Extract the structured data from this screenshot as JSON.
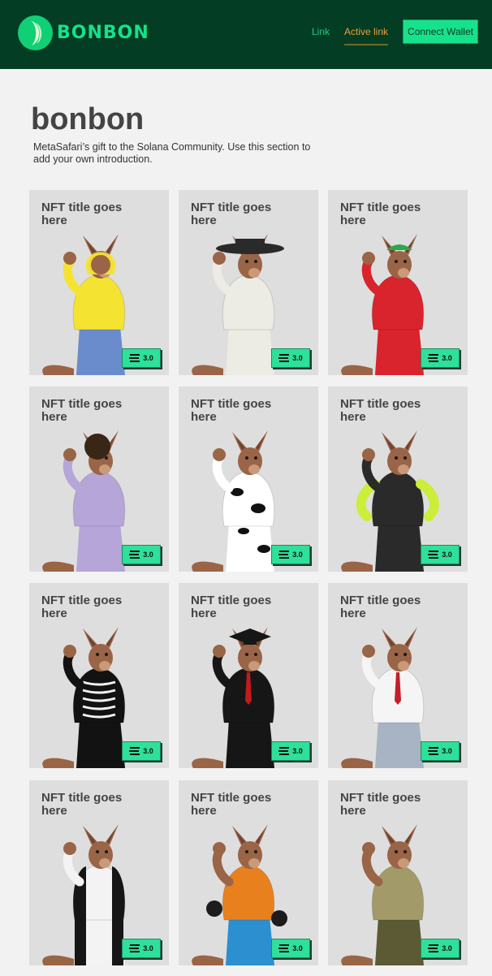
{
  "brand": {
    "name": "BONBON"
  },
  "nav": {
    "link": "Link",
    "active_link": "Active link",
    "wallet_button": "Connect Wallet"
  },
  "hero": {
    "title": "bonbon",
    "intro": "MetaSafari’s gift to the Solana Community. Use this section to add your own introduction."
  },
  "cards": [
    {
      "title": "NFT title goes here",
      "price": "3.0",
      "outfit": "yellow-raincoat",
      "colors": {
        "main": "#f4e431",
        "accent": "#6a8ccc"
      }
    },
    {
      "title": "NFT title goes here",
      "price": "3.0",
      "outfit": "black-hat-white-dress",
      "colors": {
        "main": "#ecebe4",
        "accent": "#2a2a2a"
      }
    },
    {
      "title": "NFT title goes here",
      "price": "3.0",
      "outfit": "red-jumpsuit",
      "colors": {
        "main": "#d9232d",
        "accent": "#2aa84a"
      }
    },
    {
      "title": "NFT title goes here",
      "price": "3.0",
      "outfit": "purple-shirt-afro",
      "colors": {
        "main": "#b5a5d8",
        "accent": "#3a2616"
      }
    },
    {
      "title": "NFT title goes here",
      "price": "3.0",
      "outfit": "cow-onesie",
      "colors": {
        "main": "#ffffff",
        "accent": "#111111"
      }
    },
    {
      "title": "NFT title goes here",
      "price": "3.0",
      "outfit": "wetsuit",
      "colors": {
        "main": "#2a2a2a",
        "accent": "#cbee3a"
      }
    },
    {
      "title": "NFT title goes here",
      "price": "3.0",
      "outfit": "skeleton-hoodie",
      "colors": {
        "main": "#121212",
        "accent": "#f2f2f2"
      }
    },
    {
      "title": "NFT title goes here",
      "price": "3.0",
      "outfit": "graduation-gown",
      "colors": {
        "main": "#161616",
        "accent": "#c11b1b"
      }
    },
    {
      "title": "NFT title goes here",
      "price": "3.0",
      "outfit": "suspenders-shirt",
      "colors": {
        "main": "#f5f5f5",
        "accent": "#c41e28"
      }
    },
    {
      "title": "NFT title goes here",
      "price": "3.0",
      "outfit": "panda-onesie",
      "colors": {
        "main": "#f3f3f3",
        "accent": "#161616"
      }
    },
    {
      "title": "NFT title goes here",
      "price": "3.0",
      "outfit": "boxer",
      "colors": {
        "main": "#e8801e",
        "accent": "#2b8fd0"
      }
    },
    {
      "title": "NFT title goes here",
      "price": "3.0",
      "outfit": "army-tanktop",
      "colors": {
        "main": "#a39a6a",
        "accent": "#5b5a34"
      }
    }
  ]
}
